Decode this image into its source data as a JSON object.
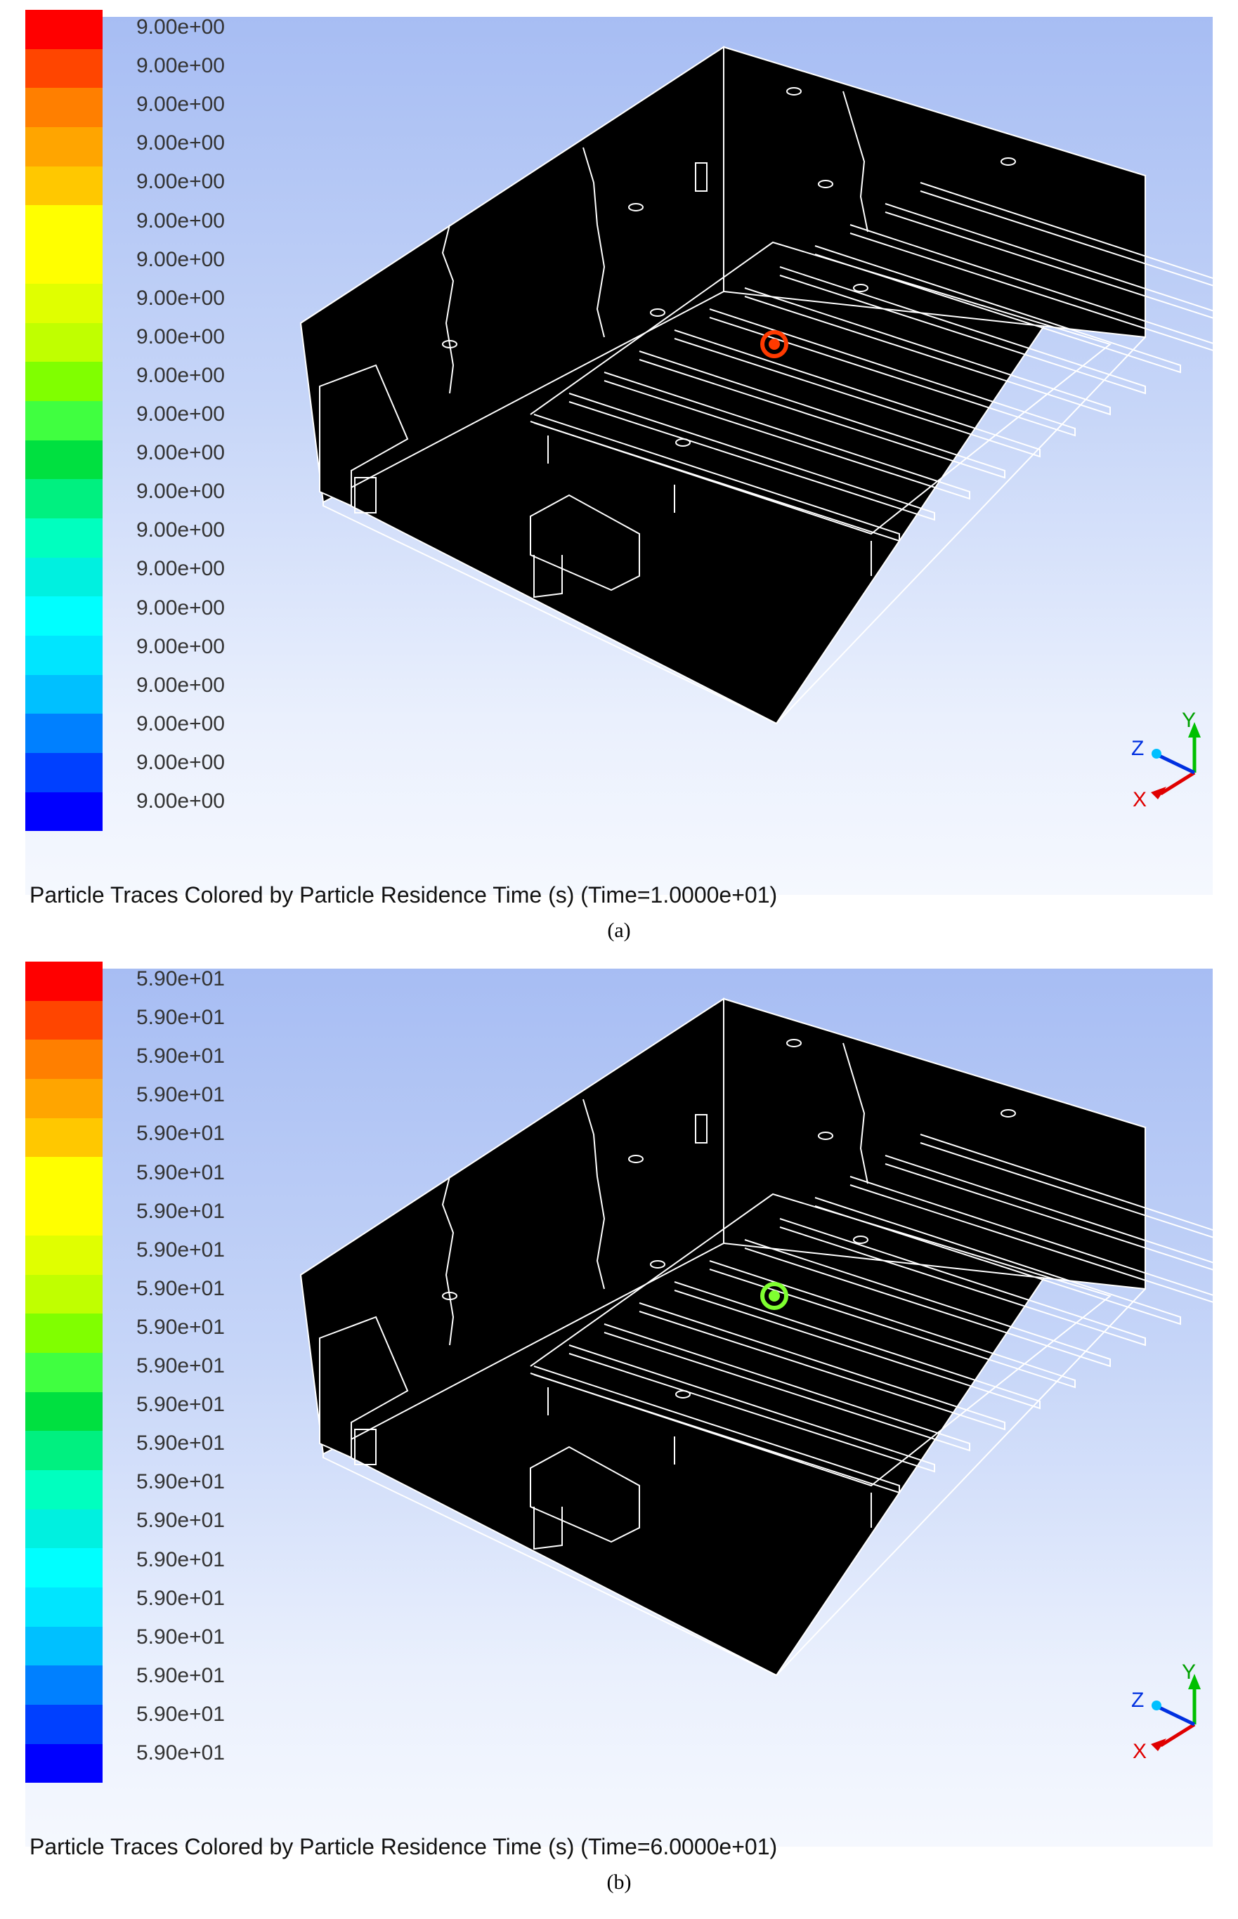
{
  "colorbar_colors": [
    "#ff0000",
    "#ff4500",
    "#ff7f00",
    "#ffa500",
    "#ffc800",
    "#ffff00",
    "#ffff00",
    "#e0ff00",
    "#c0ff00",
    "#80ff00",
    "#40ff40",
    "#00e040",
    "#00f080",
    "#00ffbf",
    "#00f0e0",
    "#00ffff",
    "#00e5ff",
    "#00c0ff",
    "#0080ff",
    "#0040ff",
    "#0000ff"
  ],
  "panels": [
    {
      "legend_labels": [
        "9.00e+00",
        "9.00e+00",
        "9.00e+00",
        "9.00e+00",
        "9.00e+00",
        "9.00e+00",
        "9.00e+00",
        "9.00e+00",
        "9.00e+00",
        "9.00e+00",
        "9.00e+00",
        "9.00e+00",
        "9.00e+00",
        "9.00e+00",
        "9.00e+00",
        "9.00e+00",
        "9.00e+00",
        "9.00e+00",
        "9.00e+00",
        "9.00e+00",
        "9.00e+00"
      ],
      "caption": "Particle Traces Colored by Particle Residence Time (s)  (Time=1.0000e+01)",
      "sublabel": "(a)",
      "particle_color": "#ff3a00",
      "axes": {
        "x": "X",
        "y": "Y",
        "z": "Z"
      }
    },
    {
      "legend_labels": [
        "5.90e+01",
        "5.90e+01",
        "5.90e+01",
        "5.90e+01",
        "5.90e+01",
        "5.90e+01",
        "5.90e+01",
        "5.90e+01",
        "5.90e+01",
        "5.90e+01",
        "5.90e+01",
        "5.90e+01",
        "5.90e+01",
        "5.90e+01",
        "5.90e+01",
        "5.90e+01",
        "5.90e+01",
        "5.90e+01",
        "5.90e+01",
        "5.90e+01",
        "5.90e+01"
      ],
      "caption": "Particle Traces Colored by Particle Residence Time (s)  (Time=6.0000e+01)",
      "sublabel": "(b)",
      "particle_color": "#7fff30",
      "axes": {
        "x": "X",
        "y": "Y",
        "z": "Z"
      }
    }
  ]
}
